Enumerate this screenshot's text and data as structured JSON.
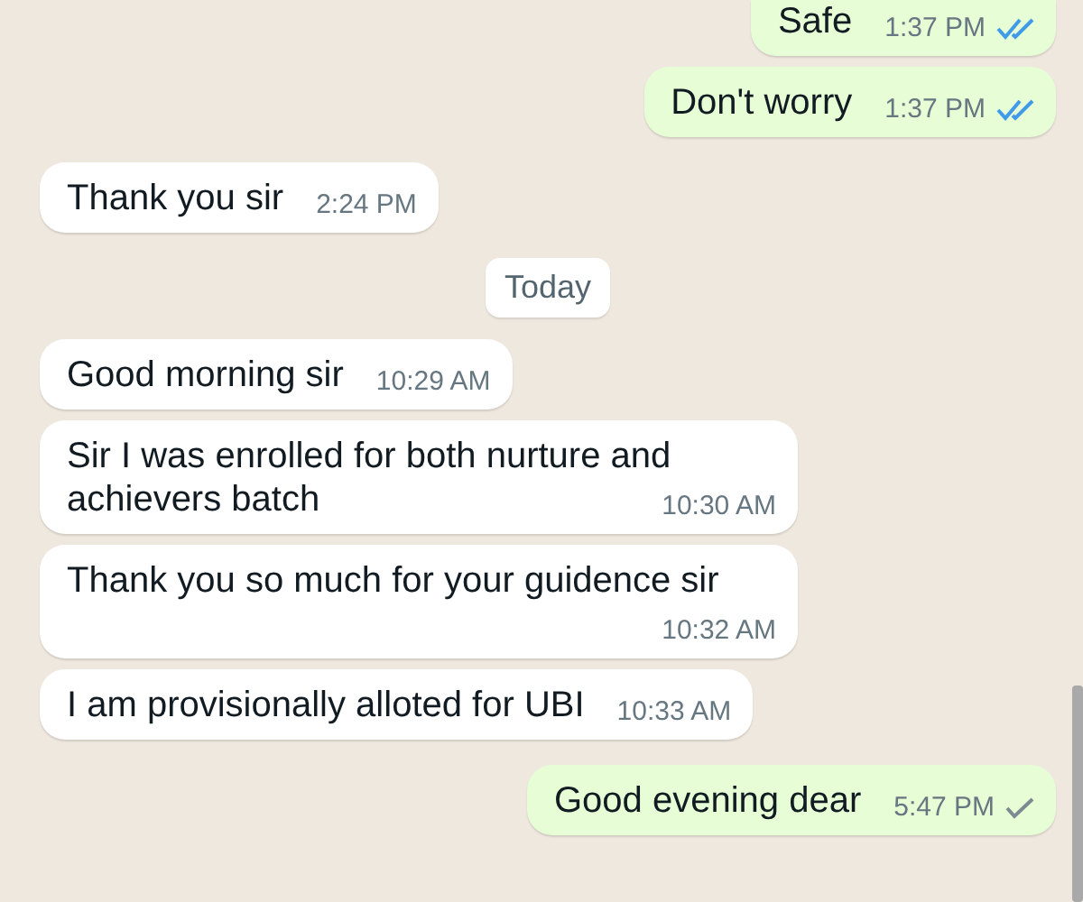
{
  "messages": [
    {
      "kind": "message",
      "outgoing": true,
      "text": "Safe",
      "time": "1:37 PM",
      "read": true
    },
    {
      "kind": "message",
      "outgoing": true,
      "text": "Don't worry",
      "time": "1:37 PM",
      "read": true
    },
    {
      "kind": "message",
      "outgoing": false,
      "text": "Thank you sir",
      "time": "2:24 PM"
    },
    {
      "kind": "date",
      "text": "Today"
    },
    {
      "kind": "message",
      "outgoing": false,
      "text": "Good morning sir",
      "time": "10:29 AM"
    },
    {
      "kind": "message",
      "outgoing": false,
      "text": "Sir I was enrolled for both nurture and achievers batch",
      "time": "10:30 AM"
    },
    {
      "kind": "message",
      "outgoing": false,
      "text": "Thank you so much for your guidence sir",
      "time": "10:32 AM"
    },
    {
      "kind": "message",
      "outgoing": false,
      "text": "I am provisionally alloted for UBI",
      "time": "10:33 AM"
    },
    {
      "kind": "message",
      "outgoing": true,
      "text": "Good evening dear",
      "time": "5:47 PM",
      "read": false
    }
  ]
}
